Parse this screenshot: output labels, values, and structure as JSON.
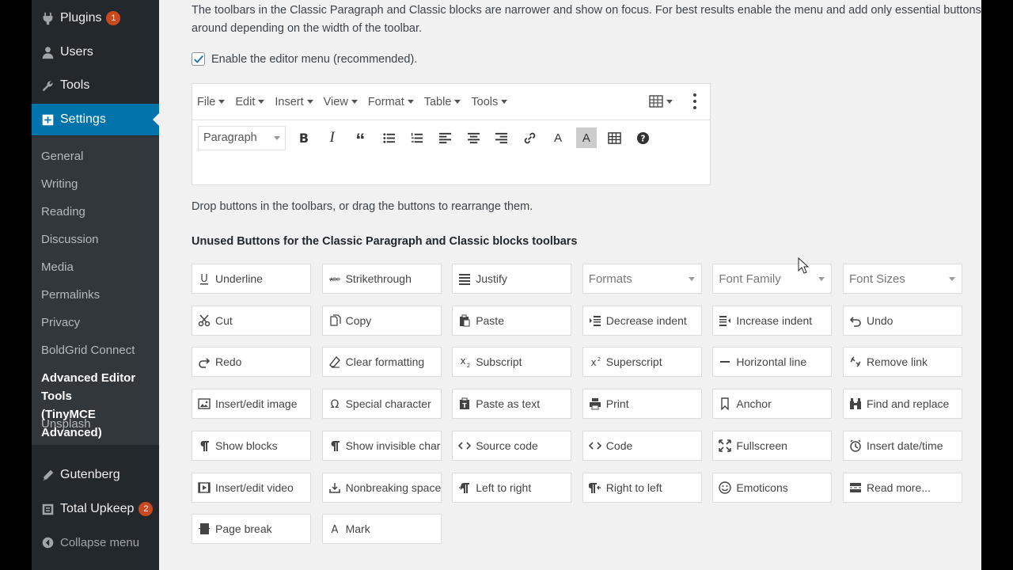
{
  "sidebar": {
    "plugins": {
      "label": "Plugins",
      "badge": "1"
    },
    "users": "Users",
    "tools": "Tools",
    "settings": "Settings",
    "submenu": [
      "General",
      "Writing",
      "Reading",
      "Discussion",
      "Media",
      "Permalinks",
      "Privacy",
      "BoldGrid Connect"
    ],
    "current_sub": [
      "Advanced Editor Tools",
      "(TinyMCE Advanced)"
    ],
    "unsplash": "Unsplash",
    "gutenberg": "Gutenberg",
    "total_upkeep": {
      "label": "Total Upkeep",
      "badge": "2"
    },
    "collapse": "Collapse menu"
  },
  "intro": {
    "line1": "The toolbars in the Classic Paragraph and Classic blocks are narrower and show on focus. For best results enable the menu and add only essential buttons. The buttons will w",
    "line2": "around depending on the width of the toolbar."
  },
  "enable_menu": {
    "label": "Enable the editor menu (recommended).",
    "checked": true
  },
  "editor": {
    "menus": [
      "File",
      "Edit",
      "Insert",
      "View",
      "Format",
      "Table",
      "Tools"
    ],
    "paragraph_select": "Paragraph",
    "toolbar_icons": [
      "bold-icon",
      "italic-icon",
      "blockquote-icon",
      "bullet-list-icon",
      "numbered-list-icon",
      "align-left-icon",
      "align-center-icon",
      "align-right-icon",
      "link-icon",
      "text-color-icon",
      "background-color-icon",
      "table-icon",
      "help-icon"
    ]
  },
  "drop_text": "Drop buttons in the toolbars, or drag the buttons to rearrange them.",
  "unused_title": "Unused Buttons for the Classic Paragraph and Classic blocks toolbars",
  "unused_buttons": [
    {
      "label": "Underline",
      "icon": "underline-icon"
    },
    {
      "label": "Strikethrough",
      "icon": "strikethrough-icon"
    },
    {
      "label": "Justify",
      "icon": "justify-icon"
    },
    {
      "label": "Formats",
      "icon": "",
      "select": true
    },
    {
      "label": "Font Family",
      "icon": "",
      "select": true
    },
    {
      "label": "Font Sizes",
      "icon": "",
      "select": true
    },
    {
      "label": "Cut",
      "icon": "cut-icon"
    },
    {
      "label": "Copy",
      "icon": "copy-icon"
    },
    {
      "label": "Paste",
      "icon": "paste-icon"
    },
    {
      "label": "Decrease indent",
      "icon": "outdent-icon"
    },
    {
      "label": "Increase indent",
      "icon": "indent-icon"
    },
    {
      "label": "Undo",
      "icon": "undo-icon"
    },
    {
      "label": "Redo",
      "icon": "redo-icon"
    },
    {
      "label": "Clear formatting",
      "icon": "eraser-icon"
    },
    {
      "label": "Subscript",
      "icon": "subscript-icon"
    },
    {
      "label": "Superscript",
      "icon": "superscript-icon"
    },
    {
      "label": "Horizontal line",
      "icon": "horizontal-line-icon"
    },
    {
      "label": "Remove link",
      "icon": "unlink-icon"
    },
    {
      "label": "Insert/edit image",
      "icon": "image-icon"
    },
    {
      "label": "Special character",
      "icon": "omega-icon"
    },
    {
      "label": "Paste as text",
      "icon": "paste-text-icon"
    },
    {
      "label": "Print",
      "icon": "print-icon"
    },
    {
      "label": "Anchor",
      "icon": "bookmark-icon"
    },
    {
      "label": "Find and replace",
      "icon": "binoculars-icon"
    },
    {
      "label": "Show blocks",
      "icon": "pilcrow-icon"
    },
    {
      "label": "Show invisible chara...",
      "icon": "pilcrow-icon"
    },
    {
      "label": "Source code",
      "icon": "code-icon"
    },
    {
      "label": "Code",
      "icon": "code-icon"
    },
    {
      "label": "Fullscreen",
      "icon": "fullscreen-icon"
    },
    {
      "label": "Insert date/time",
      "icon": "clock-icon"
    },
    {
      "label": "Insert/edit video",
      "icon": "video-icon"
    },
    {
      "label": "Nonbreaking space",
      "icon": "nbsp-icon"
    },
    {
      "label": "Left to right",
      "icon": "ltr-icon"
    },
    {
      "label": "Right to left",
      "icon": "rtl-icon"
    },
    {
      "label": "Emoticons",
      "icon": "smiley-icon"
    },
    {
      "label": "Read more...",
      "icon": "read-more-icon"
    },
    {
      "label": "Page break",
      "icon": "page-break-icon"
    },
    {
      "label": "Mark",
      "icon": "mark-icon"
    }
  ],
  "colors": {
    "sidebar": "#23282d",
    "submenu": "#32373c",
    "accent": "#0073aa",
    "badge": "#ca4a1f"
  }
}
